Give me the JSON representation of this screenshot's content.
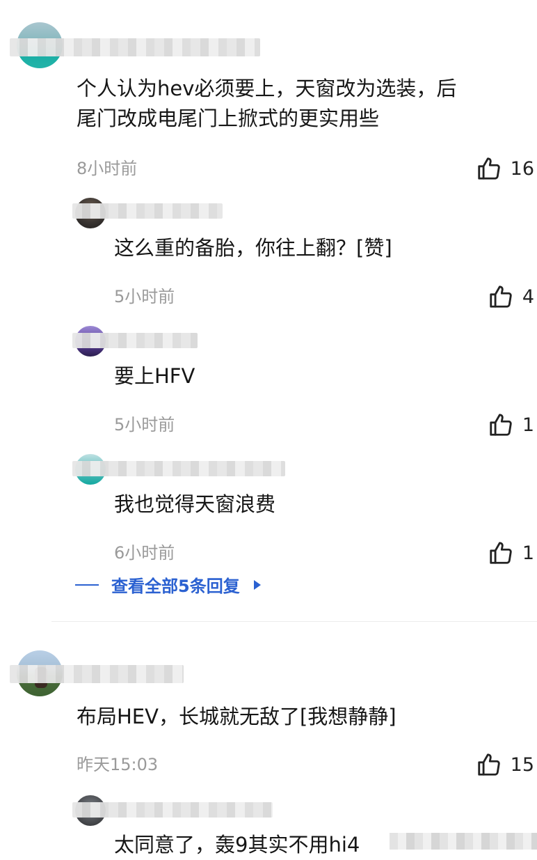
{
  "comments": [
    {
      "text": "个人认为hev必须要上，天窗改为选装，后\n尾门改成电尾门上掀式的更实用些",
      "time": "8小时前",
      "likes": "16",
      "replies": [
        {
          "text": "这么重的备胎，你往上翻？[赞]",
          "time": "5小时前",
          "likes": "4"
        },
        {
          "text": "要上HFV",
          "time": "5小时前",
          "likes": "1"
        },
        {
          "text": "我也觉得天窗浪费",
          "time": "6小时前",
          "likes": "1"
        }
      ],
      "view_all_replies": "查看全部5条回复"
    },
    {
      "text": "布局HEV，长城就无敌了[我想静静]",
      "time": "昨天15:03",
      "likes": "15",
      "replies": [
        {
          "text": "太同意了，轰9其实不用hi4"
        }
      ]
    }
  ],
  "icons": {
    "like": "thumbs-up-icon",
    "expand": "triangle-right-icon"
  },
  "colors": {
    "link": "#2b61d1",
    "time": "#9a9a9a"
  }
}
